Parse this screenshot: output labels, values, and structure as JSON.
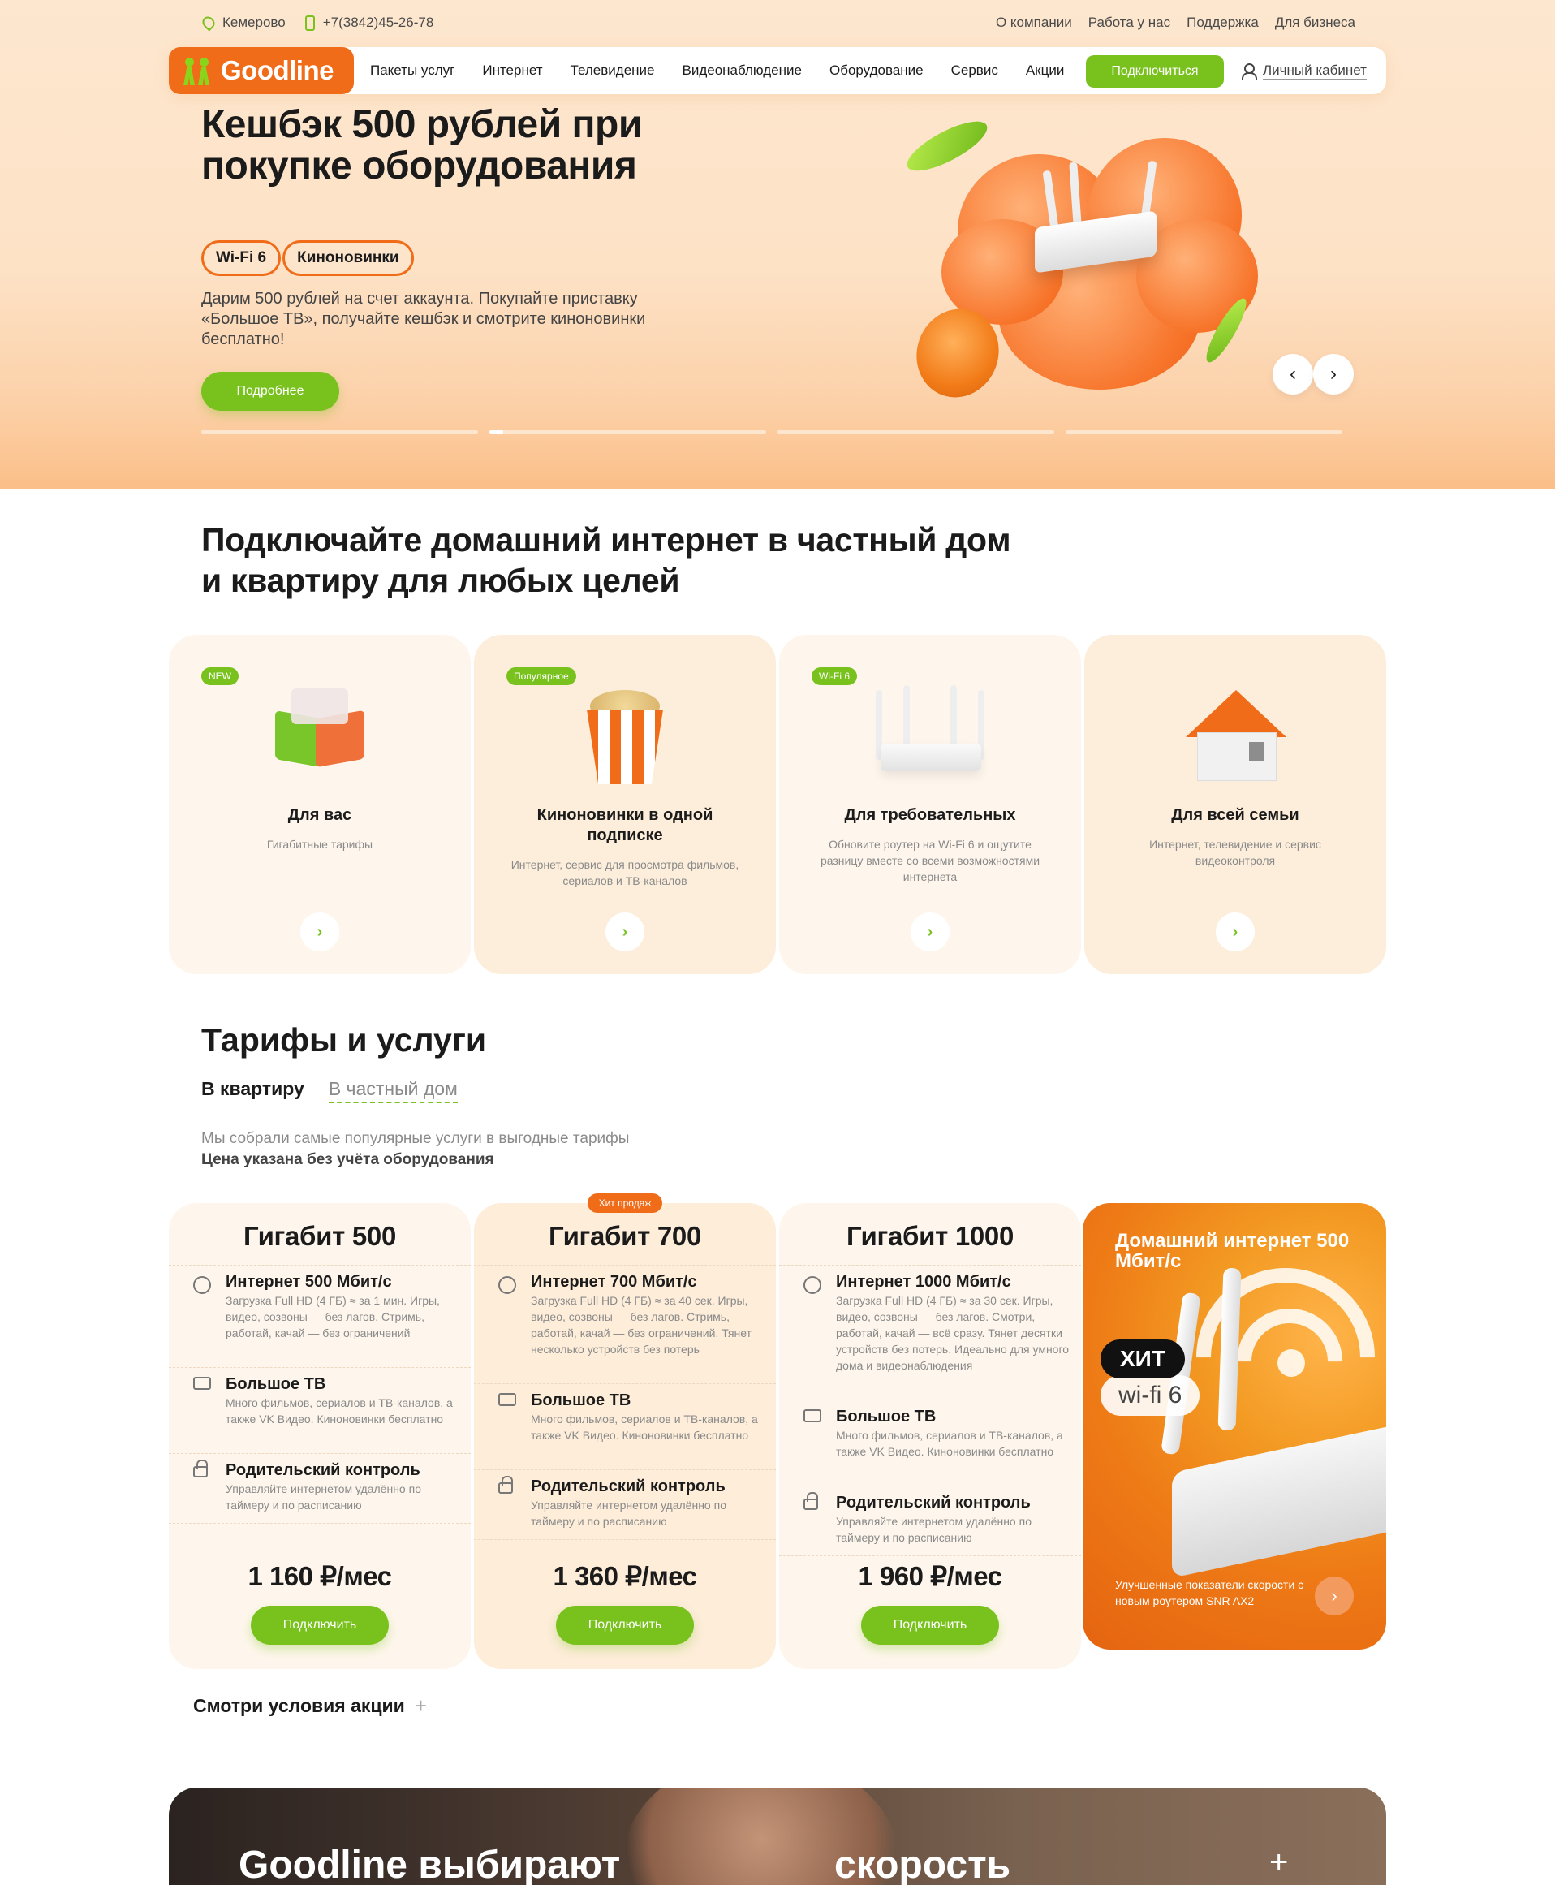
{
  "topbar": {
    "city": "Кемерово",
    "phone": "+7(3842)45-26-78",
    "links": [
      "О компании",
      "Работа у нас",
      "Поддержка",
      "Для бизнеса"
    ]
  },
  "nav": {
    "logo": "Goodline",
    "items": [
      "Пакеты услуг",
      "Интернет",
      "Телевидение",
      "Видеонаблюдение",
      "Оборудование",
      "Сервис",
      "Акции"
    ],
    "connect": "Подключиться",
    "cabinet": "Личный кабинет"
  },
  "hero": {
    "title": "Кешбэк 500 рублей при покупке оборудования",
    "chips": [
      "Wi-Fi 6",
      "Киноновинки"
    ],
    "description": "Дарим 500 рублей на счет аккаунта. Покупайте приставку «Большое ТВ», получайте кешбэк и смотрите киноновинки бесплатно!",
    "button": "Подробнее",
    "prev": "‹",
    "next": "›",
    "slides_progress": [
      0,
      0.05,
      0,
      0
    ]
  },
  "section_internet": {
    "title": "Подключайте домашний интернет в частный дом и квартиру для любых целей",
    "cards": [
      {
        "badge": "NEW",
        "title": "Для вас",
        "text": "Гигабитные тарифы"
      },
      {
        "badge": "Популярное",
        "title": "Киноновинки в одной подписке",
        "text": "Интернет, сервис для просмотра фильмов, сериалов и ТВ-каналов"
      },
      {
        "badge": "Wi-Fi 6",
        "title": "Для требовательных",
        "text": "Обновите роутер на Wi-Fi 6 и ощутите разницу вместе со всеми возможностями интернета"
      },
      {
        "badge": "",
        "title": "Для всей семьи",
        "text": "Интернет, телевидение и сервис видеоконтроля"
      }
    ],
    "arrow": "›"
  },
  "tariffs": {
    "title": "Тарифы и услуги",
    "tab_active": "В квартиру",
    "tab_other": "В частный дом",
    "note": "Мы собрали самые популярные услуги в выгодные тарифы",
    "note_bold": "Цена указана без учёта оборудования",
    "hit_label": "Хит продаж",
    "plans": [
      {
        "name": "Гигабит 500",
        "f1_title": "Интернет 500 Мбит/с",
        "f1_text": "Загрузка Full HD (4 ГБ) ≈ за 1 мин. Игры, видео, созвоны — без лагов. Стримь, работай, качай — без ограничений",
        "f2_title": "Большое ТВ",
        "f2_text": "Много фильмов, сериалов и ТВ-каналов, а также VK Видео. Киноновинки бесплатно",
        "f3_title": "Родительский контроль",
        "f3_text": "Управляйте интернетом удалённо по таймеру и по расписанию",
        "price": "1 160 ₽/мес",
        "button": "Подключить"
      },
      {
        "name": "Гигабит 700",
        "f1_title": "Интернет 700 Мбит/с",
        "f1_text": "Загрузка Full HD (4 ГБ) ≈ за 40 сек. Игры, видео, созвоны — без лагов. Стримь, работай, качай — без ограничений. Тянет несколько устройств без потерь",
        "f2_title": "Большое ТВ",
        "f2_text": "Много фильмов, сериалов и ТВ-каналов, а также VK Видео. Киноновинки бесплатно",
        "f3_title": "Родительский контроль",
        "f3_text": "Управляйте интернетом удалённо по таймеру и по расписанию",
        "price": "1 360 ₽/мес",
        "button": "Подключить"
      },
      {
        "name": "Гигабит 1000",
        "f1_title": "Интернет 1000 Мбит/с",
        "f1_text": "Загрузка Full HD (4 ГБ) ≈ за 30 сек. Игры, видео, созвоны — без лагов. Смотри, работай, качай — всё сразу. Тянет десятки устройств без потерь. Идеально для умного дома и видеонаблюдения",
        "f2_title": "Большое ТВ",
        "f2_text": "Много фильмов, сериалов и ТВ-каналов, а также VK Видео. Киноновинки бесплатно",
        "f3_title": "Родительский контроль",
        "f3_text": "Управляйте интернетом удалённо по таймеру и по расписанию",
        "price": "1 960 ₽/мес",
        "button": "Подключить"
      }
    ],
    "promo": {
      "title": "Домашний интернет 500 Мбит/с",
      "hit": "ХИТ",
      "wifi": "wi-fi 6",
      "text": "Улучшенные показатели скорости с новым роутером SNR AX2",
      "arrow": "›"
    },
    "terms": "Смотри условия акции",
    "terms_plus": "+"
  },
  "banner": {
    "left": "Goodline выбирают",
    "right": "скорость",
    "plus": "+"
  },
  "colors": {
    "brand_orange": "#f06c18",
    "brand_green": "#79c21e"
  }
}
